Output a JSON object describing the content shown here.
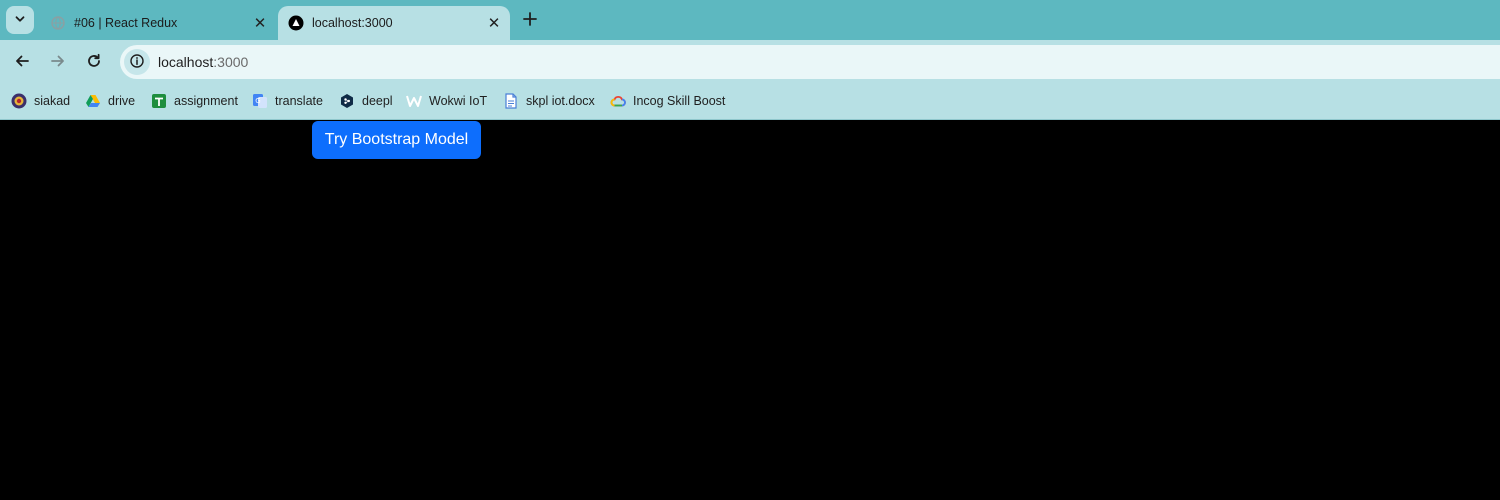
{
  "tabs": [
    {
      "title": "#06 | React Redux",
      "active": false
    },
    {
      "title": "localhost:3000",
      "active": true
    }
  ],
  "toolbar": {
    "url_host": "localhost",
    "url_port": ":3000"
  },
  "bookmarks": [
    {
      "label": "siakad",
      "icon": "university-seal-icon"
    },
    {
      "label": "drive",
      "icon": "google-drive-icon"
    },
    {
      "label": "assignment",
      "icon": "google-sheets-icon"
    },
    {
      "label": "translate",
      "icon": "google-translate-icon"
    },
    {
      "label": "deepl",
      "icon": "deepl-icon"
    },
    {
      "label": "Wokwi IoT",
      "icon": "wokwi-icon"
    },
    {
      "label": "skpl iot.docx",
      "icon": "document-icon"
    },
    {
      "label": "Incog Skill Boost",
      "icon": "google-cloud-icon"
    }
  ],
  "page": {
    "button_label": "Try Bootstrap Model"
  },
  "colors": {
    "tabstrip": "#5db8c0",
    "toolbar": "#b7e0e4",
    "primary_button": "#0d6efd",
    "page_background": "#000000"
  }
}
